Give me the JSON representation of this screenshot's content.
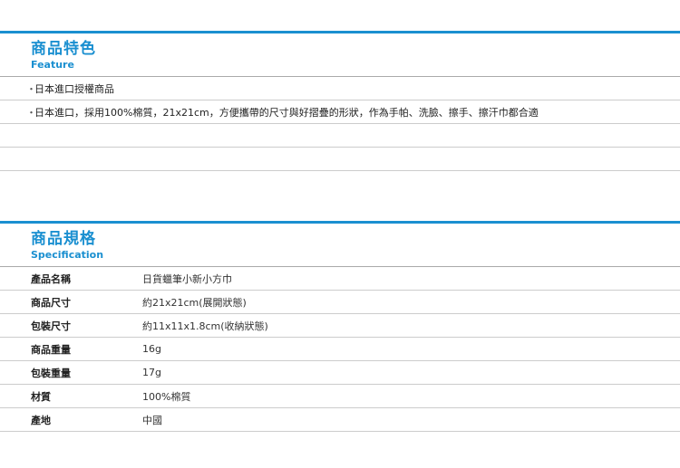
{
  "features": {
    "title": "商品特色",
    "subtitle": "Feature",
    "items": [
      "日本進口授權商品",
      "日本進口，採用100%棉質，21x21cm，方便攜帶的尺寸與好摺疊的形狀，作為手帕、洗臉、擦手、擦汗巾都合適",
      "",
      ""
    ]
  },
  "spec": {
    "title": "商品規格",
    "subtitle": "Specification",
    "rows": [
      {
        "label": "產品名稱",
        "value": "日貨蠟筆小新小方巾"
      },
      {
        "label": "商品尺寸",
        "value": "約21x21cm(展開狀態)"
      },
      {
        "label": "包裝尺寸",
        "value": "約11x11x1.8cm(收納狀態)"
      },
      {
        "label": "商品重量",
        "value": "16g"
      },
      {
        "label": "包裝重量",
        "value": "17g"
      },
      {
        "label": "材質",
        "value": "100%棉質"
      },
      {
        "label": "產地",
        "value": "中國"
      }
    ]
  },
  "colors": {
    "accent": "#1a8fd0",
    "divider": "#cccccc"
  },
  "bullet_glyph": "・"
}
